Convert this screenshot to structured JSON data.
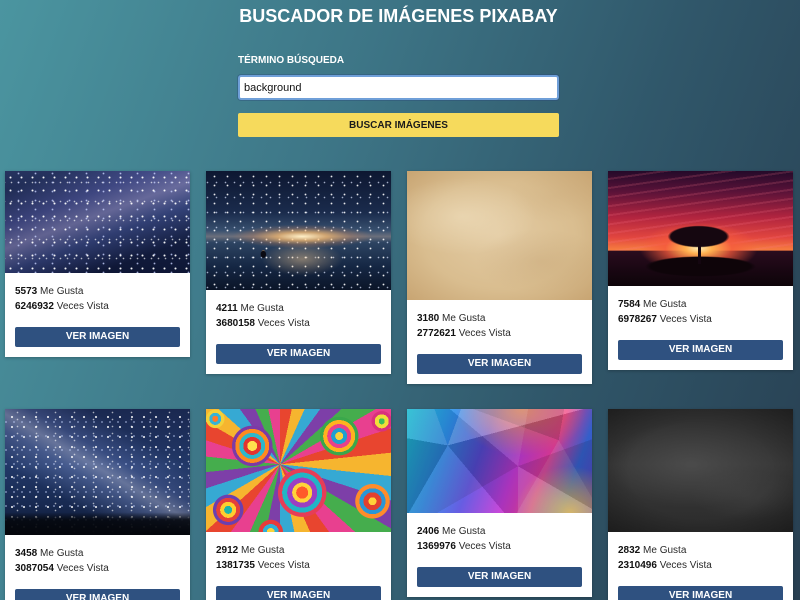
{
  "header": {
    "title": "BUSCADOR DE IMÁGENES PIXABAY"
  },
  "search": {
    "label": "TÉRMINO BÚSQUEDA",
    "value": "background",
    "button_label": "BUSCAR IMÁGENES"
  },
  "labels": {
    "likes": "Me Gusta",
    "views": "Veces Vista",
    "view_button": "VER IMAGEN"
  },
  "images": [
    {
      "likes": 5573,
      "views": 6246932
    },
    {
      "likes": 4211,
      "views": 3680158
    },
    {
      "likes": 3180,
      "views": 2772621
    },
    {
      "likes": 7584,
      "views": 6978267
    },
    {
      "likes": 3458,
      "views": 3087054
    },
    {
      "likes": 2912,
      "views": 1381735
    },
    {
      "likes": 2406,
      "views": 1369976
    },
    {
      "likes": 2832,
      "views": 2310496
    }
  ],
  "colors": {
    "background_start": "#4b95a0",
    "background_end": "#283f51",
    "search_button": "#f6da5c",
    "view_button": "#2f5180",
    "input_focus_border": "#6f9fd8"
  }
}
